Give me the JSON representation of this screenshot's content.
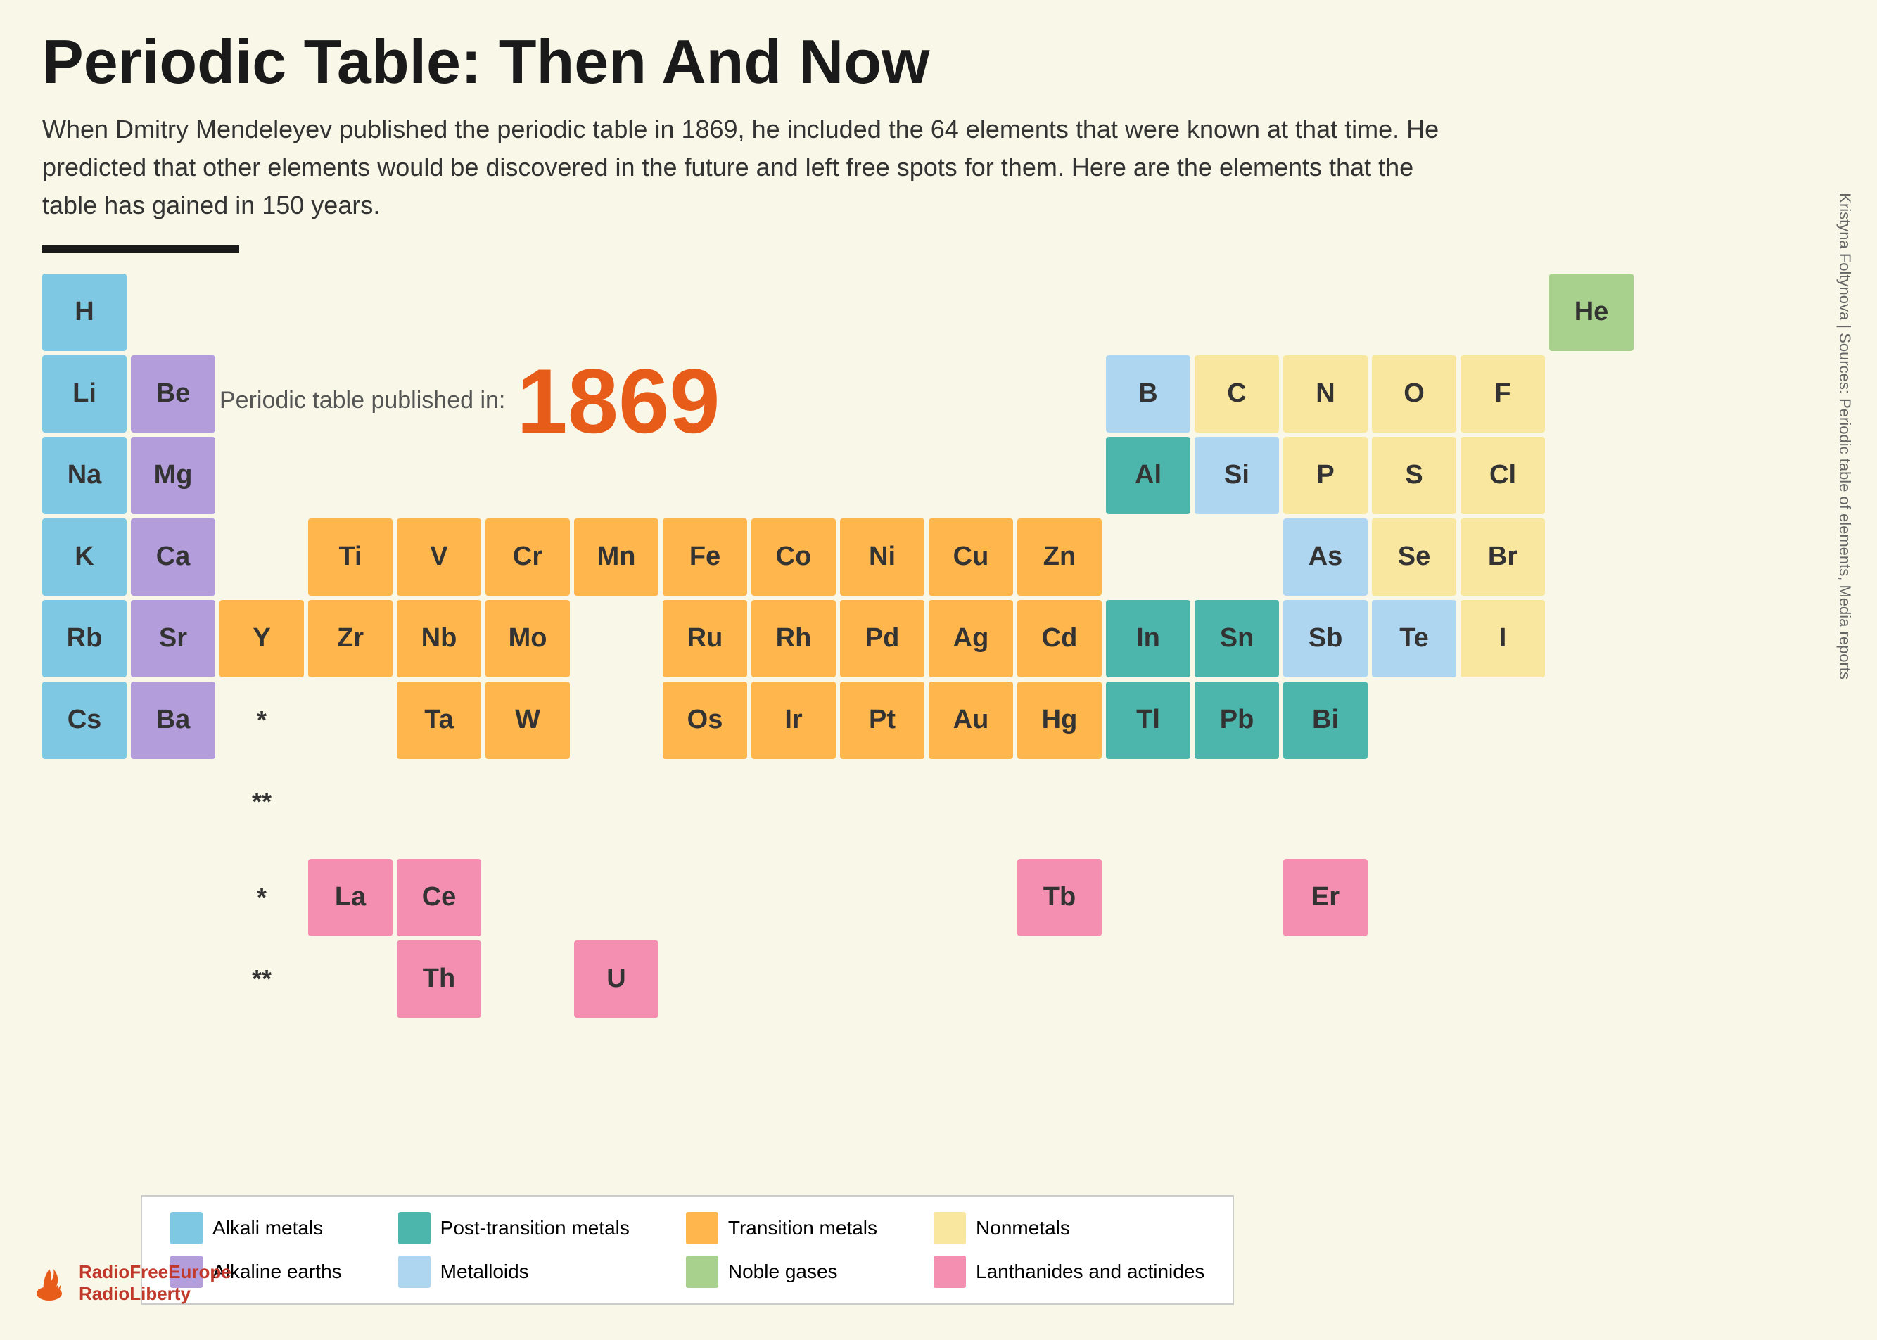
{
  "title": "Periodic Table: Then And Now",
  "subtitle": "When Dmitry Mendeleyev published the periodic table in 1869, he included the 64 elements that were known at that time. He predicted that other elements would be discovered in the future and left free spots for them. Here are the elements that the table has gained in 150 years.",
  "year_label": "Periodic table published in:",
  "year_value": "1869",
  "source": "Sources: Periodic table of elements, Media reports",
  "author": "Kristyna Foltynova",
  "logo_line1": "RadioFreeEurope",
  "logo_line2": "RadioLiberty",
  "legend": {
    "items": [
      {
        "label": "Alkali metals",
        "color": "#7ec8e3"
      },
      {
        "label": "Alkaline earths",
        "color": "#b39ddb"
      },
      {
        "label": "Post-transition metals",
        "color": "#4db6ac"
      },
      {
        "label": "Metalloids",
        "color": "#aed6f1"
      },
      {
        "label": "Transition metals",
        "color": "#ffb74d"
      },
      {
        "label": "Noble gases",
        "color": "#a9d18e"
      },
      {
        "label": "Nonmetals",
        "color": "#f9e79f"
      },
      {
        "label": "Lanthanides and actinides",
        "color": "#f48fb1"
      }
    ]
  },
  "elements": {
    "row1": [
      {
        "symbol": "H",
        "type": "alkali",
        "col": 1
      },
      {
        "symbol": "He",
        "type": "noble-gas",
        "col": 18
      }
    ],
    "row2": [
      {
        "symbol": "Li",
        "type": "alkali",
        "col": 1
      },
      {
        "symbol": "Be",
        "type": "alkaline",
        "col": 2
      },
      {
        "symbol": "B",
        "type": "metalloid",
        "col": 13
      },
      {
        "symbol": "C",
        "type": "nonmetal",
        "col": 14
      },
      {
        "symbol": "N",
        "type": "nonmetal",
        "col": 15
      },
      {
        "symbol": "O",
        "type": "nonmetal",
        "col": 16
      },
      {
        "symbol": "F",
        "type": "nonmetal",
        "col": 17
      }
    ],
    "row3": [
      {
        "symbol": "Na",
        "type": "alkali",
        "col": 1
      },
      {
        "symbol": "Mg",
        "type": "alkaline",
        "col": 2
      },
      {
        "symbol": "Al",
        "type": "post-transition",
        "col": 13
      },
      {
        "symbol": "Si",
        "type": "metalloid",
        "col": 14
      },
      {
        "symbol": "P",
        "type": "nonmetal",
        "col": 15
      },
      {
        "symbol": "S",
        "type": "nonmetal",
        "col": 16
      },
      {
        "symbol": "Cl",
        "type": "nonmetal",
        "col": 17
      }
    ],
    "row4": [
      {
        "symbol": "K",
        "type": "alkali",
        "col": 1
      },
      {
        "symbol": "Ca",
        "type": "alkaline",
        "col": 2
      },
      {
        "symbol": "Ti",
        "type": "transition",
        "col": 4
      },
      {
        "symbol": "V",
        "type": "transition",
        "col": 5
      },
      {
        "symbol": "Cr",
        "type": "transition",
        "col": 6
      },
      {
        "symbol": "Mn",
        "type": "transition",
        "col": 7
      },
      {
        "symbol": "Fe",
        "type": "transition",
        "col": 8
      },
      {
        "symbol": "Co",
        "type": "transition",
        "col": 9
      },
      {
        "symbol": "Ni",
        "type": "transition",
        "col": 10
      },
      {
        "symbol": "Cu",
        "type": "transition",
        "col": 11
      },
      {
        "symbol": "Zn",
        "type": "transition",
        "col": 12
      },
      {
        "symbol": "As",
        "type": "metalloid",
        "col": 15
      },
      {
        "symbol": "Se",
        "type": "nonmetal",
        "col": 16
      },
      {
        "symbol": "Br",
        "type": "nonmetal",
        "col": 17
      }
    ],
    "row5": [
      {
        "symbol": "Rb",
        "type": "alkali",
        "col": 1
      },
      {
        "symbol": "Sr",
        "type": "alkaline",
        "col": 2
      },
      {
        "symbol": "Y",
        "type": "transition",
        "col": 3
      },
      {
        "symbol": "Zr",
        "type": "transition",
        "col": 4
      },
      {
        "symbol": "Nb",
        "type": "transition",
        "col": 5
      },
      {
        "symbol": "Mo",
        "type": "transition",
        "col": 6
      },
      {
        "symbol": "Ru",
        "type": "transition",
        "col": 8
      },
      {
        "symbol": "Rh",
        "type": "transition",
        "col": 9
      },
      {
        "symbol": "Pd",
        "type": "transition",
        "col": 10
      },
      {
        "symbol": "Ag",
        "type": "transition",
        "col": 11
      },
      {
        "symbol": "Cd",
        "type": "transition",
        "col": 12
      },
      {
        "symbol": "In",
        "type": "post-transition",
        "col": 13
      },
      {
        "symbol": "Sn",
        "type": "post-transition",
        "col": 14
      },
      {
        "symbol": "Sb",
        "type": "metalloid",
        "col": 15
      },
      {
        "symbol": "Te",
        "type": "metalloid",
        "col": 16
      },
      {
        "symbol": "I",
        "type": "nonmetal",
        "col": 17
      }
    ],
    "row6": [
      {
        "symbol": "Cs",
        "type": "alkali",
        "col": 1
      },
      {
        "symbol": "Ba",
        "type": "alkaline",
        "col": 2
      },
      {
        "symbol": "*",
        "type": "label",
        "col": 3
      },
      {
        "symbol": "Ta",
        "type": "transition",
        "col": 5
      },
      {
        "symbol": "W",
        "type": "transition",
        "col": 6
      },
      {
        "symbol": "Os",
        "type": "transition",
        "col": 8
      },
      {
        "symbol": "Ir",
        "type": "transition",
        "col": 9
      },
      {
        "symbol": "Pt",
        "type": "transition",
        "col": 10
      },
      {
        "symbol": "Au",
        "type": "transition",
        "col": 11
      },
      {
        "symbol": "Hg",
        "type": "transition",
        "col": 12
      },
      {
        "symbol": "Tl",
        "type": "post-transition",
        "col": 13
      },
      {
        "symbol": "Pb",
        "type": "post-transition",
        "col": 14
      },
      {
        "symbol": "Bi",
        "type": "post-transition",
        "col": 15
      }
    ],
    "row7": [
      {
        "symbol": "**",
        "type": "label",
        "col": 3
      }
    ]
  }
}
